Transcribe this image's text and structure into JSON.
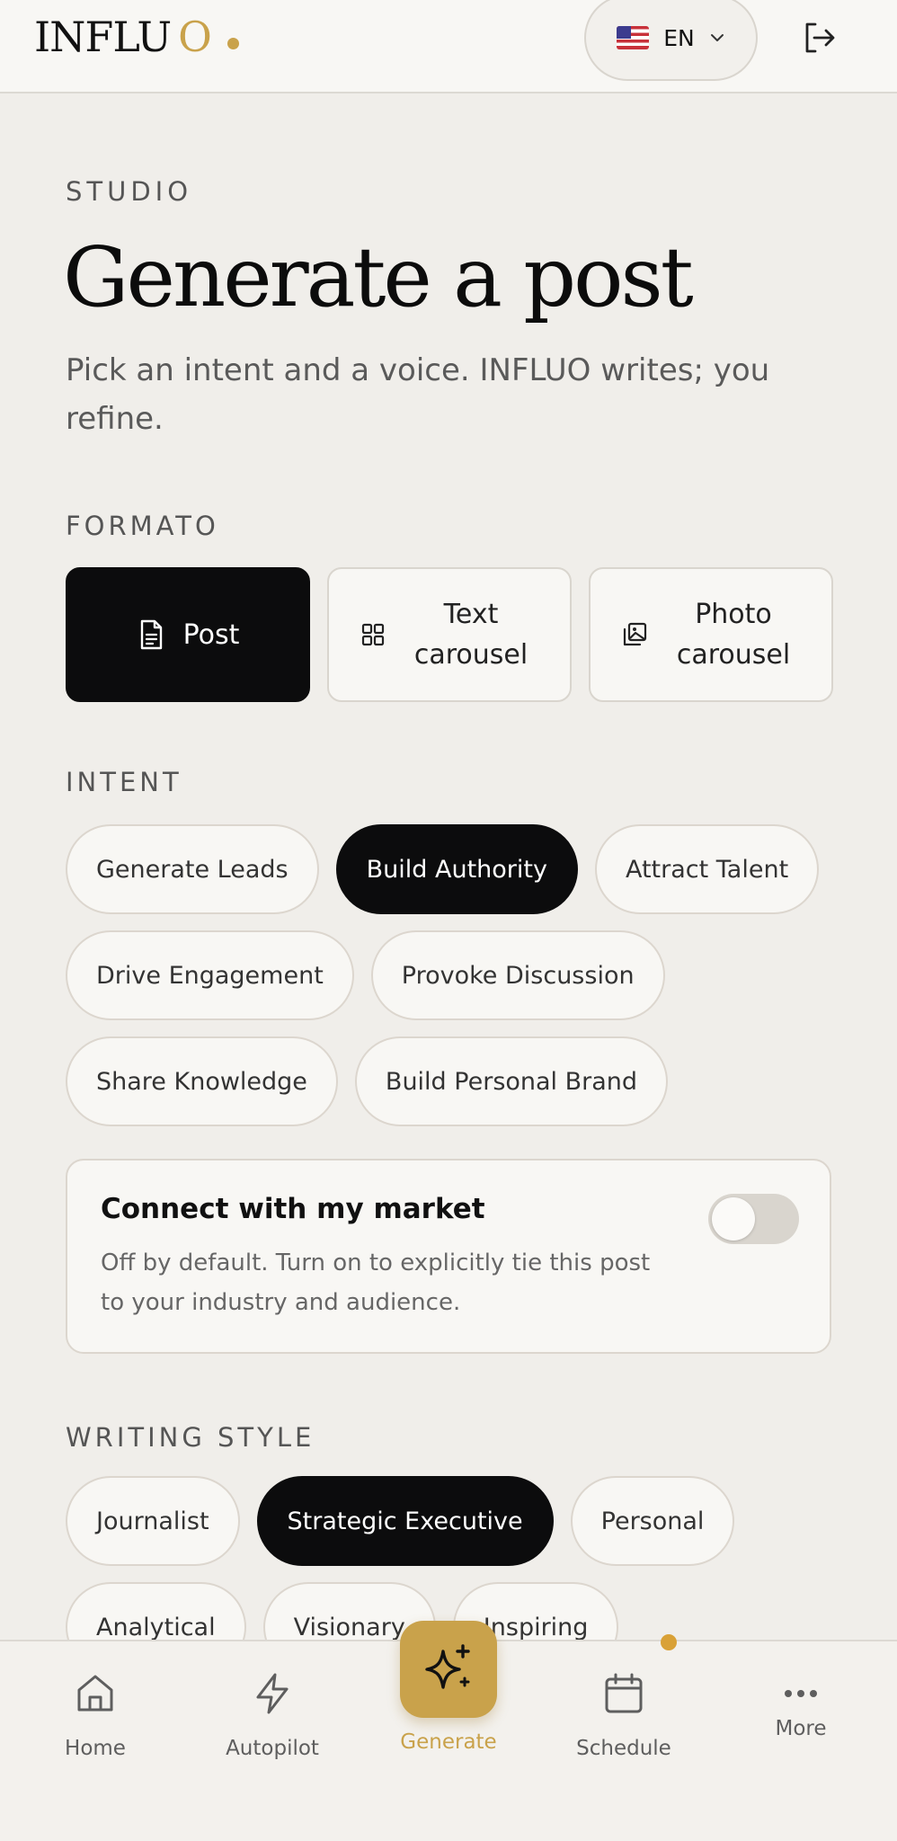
{
  "header": {
    "logo_main": "INFLU",
    "logo_accent": "O",
    "language_code": "EN",
    "flag_icon": "us-flag-icon",
    "chevron_icon": "chevron-down-icon",
    "logout_icon": "logout-icon"
  },
  "hero": {
    "eyebrow": "STUDIO",
    "title": "Generate a post",
    "subtitle": "Pick an intent and a voice. INFLUO writes; you refine."
  },
  "format": {
    "label": "FORMATO",
    "options": [
      {
        "label": "Post",
        "icon": "document-icon",
        "selected": true
      },
      {
        "label": "Text carousel",
        "icon": "grid-icon",
        "selected": false
      },
      {
        "label": "Photo carousel",
        "icon": "images-icon",
        "selected": false
      }
    ]
  },
  "intent": {
    "label": "INTENT",
    "options": [
      {
        "label": "Generate Leads",
        "selected": false
      },
      {
        "label": "Build Authority",
        "selected": true
      },
      {
        "label": "Attract Talent",
        "selected": false
      },
      {
        "label": "Drive Engagement",
        "selected": false
      },
      {
        "label": "Provoke Discussion",
        "selected": false
      },
      {
        "label": "Share Knowledge",
        "selected": false
      },
      {
        "label": "Build Personal Brand",
        "selected": false
      }
    ]
  },
  "market": {
    "title": "Connect with my market",
    "description": "Off by default. Turn on to explicitly tie this post to your industry and audience.",
    "enabled": false
  },
  "writing_style": {
    "label": "WRITING STYLE",
    "options": [
      {
        "label": "Journalist",
        "selected": false
      },
      {
        "label": "Strategic Executive",
        "selected": true
      },
      {
        "label": "Personal",
        "selected": false
      },
      {
        "label": "Analytical",
        "selected": false
      },
      {
        "label": "Visionary",
        "selected": false
      },
      {
        "label": "Inspiring",
        "selected": false
      }
    ]
  },
  "nav": {
    "items": [
      {
        "label": "Home",
        "icon": "home-icon"
      },
      {
        "label": "Autopilot",
        "icon": "lightning-icon"
      },
      {
        "label": "Generate",
        "icon": "sparkle-icon",
        "active": true
      },
      {
        "label": "Schedule",
        "icon": "calendar-icon"
      },
      {
        "label": "More",
        "icon": "more-icon"
      }
    ]
  },
  "colors": {
    "background": "#f0eeea",
    "surface": "#f8f7f4",
    "selected": "#0c0c0d",
    "accent": "#c9a24b",
    "border": "#d9d5ce"
  }
}
